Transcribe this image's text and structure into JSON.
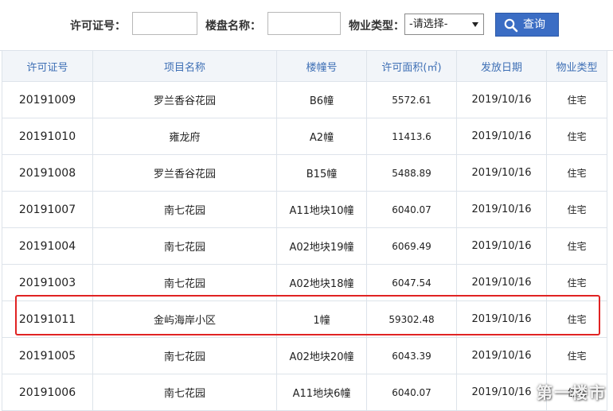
{
  "search": {
    "license_label": "许可证号：",
    "project_label": "楼盘名称：",
    "type_label": "物业类型：",
    "license_value": "",
    "project_value": "",
    "type_selected": "-请选择-",
    "button_label": "查询"
  },
  "table": {
    "headers": [
      "许可证号",
      "项目名称",
      "楼幢号",
      "许可面积(㎡)",
      "发放日期",
      "物业类型"
    ],
    "rows": [
      [
        "20191009",
        "罗兰香谷花园",
        "B6幢",
        "5572.61",
        "2019/10/16",
        "住宅"
      ],
      [
        "20191010",
        "雍龙府",
        "A2幢",
        "11413.6",
        "2019/10/16",
        "住宅"
      ],
      [
        "20191008",
        "罗兰香谷花园",
        "B15幢",
        "5488.89",
        "2019/10/16",
        "住宅"
      ],
      [
        "20191007",
        "南七花园",
        "A11地块10幢",
        "6040.07",
        "2019/10/16",
        "住宅"
      ],
      [
        "20191004",
        "南七花园",
        "A02地块19幢",
        "6069.49",
        "2019/10/16",
        "住宅"
      ],
      [
        "20191003",
        "南七花园",
        "A02地块18幢",
        "6047.54",
        "2019/10/16",
        "住宅"
      ],
      [
        "20191011",
        "金屿海岸小区",
        "1幢",
        "59302.48",
        "2019/10/16",
        "住宅"
      ],
      [
        "20191005",
        "南七花园",
        "A02地块20幢",
        "6043.39",
        "2019/10/16",
        "住宅"
      ],
      [
        "20191006",
        "南七花园",
        "A11地块6幢",
        "6040.07",
        "2019/10/16",
        "住宅"
      ]
    ]
  },
  "watermark": "第一楼市",
  "colors": {
    "header_text": "#3e6fb5",
    "button_bg": "#3b6dc4",
    "highlight_border": "#e02323"
  }
}
